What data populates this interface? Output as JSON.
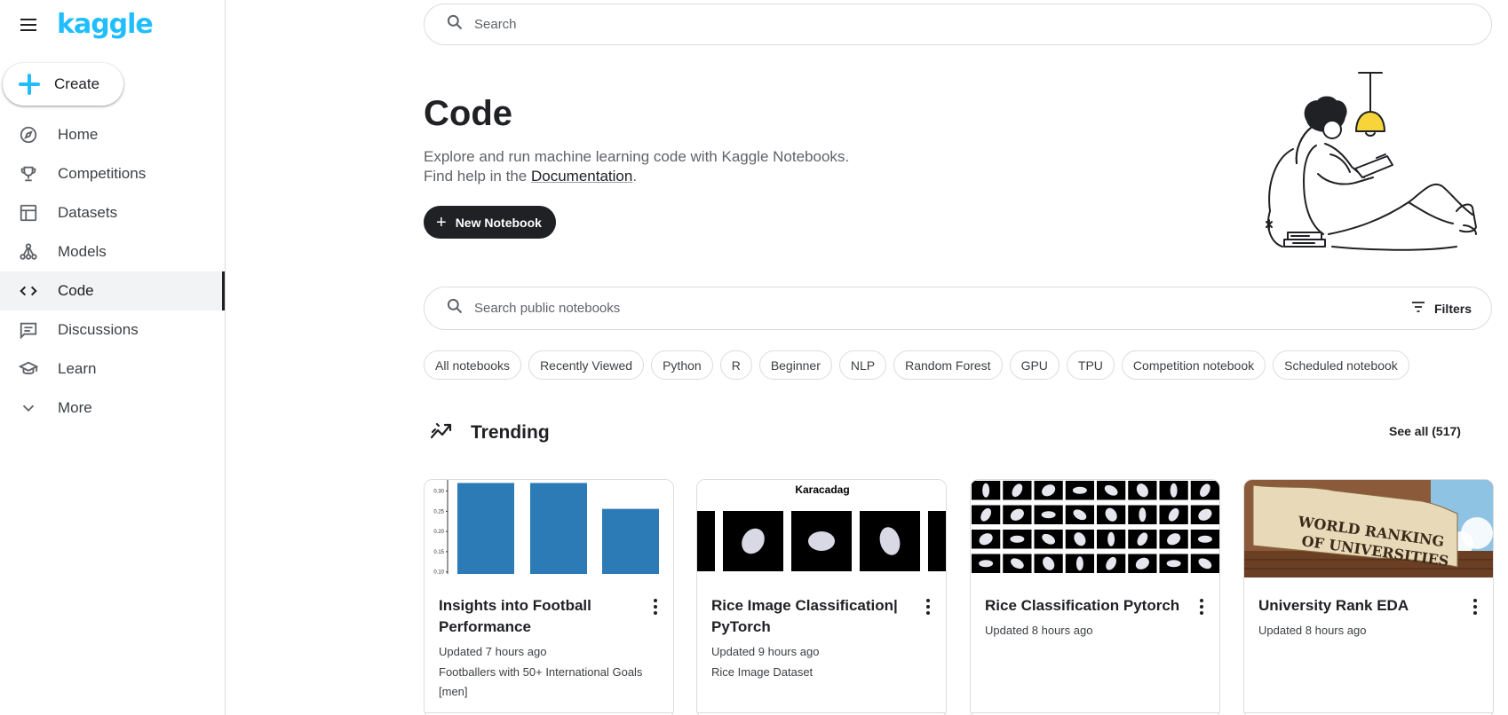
{
  "sidebar": {
    "logo": "kaggle",
    "create_label": "Create",
    "items": [
      {
        "label": "Home",
        "icon": "compass-icon"
      },
      {
        "label": "Competitions",
        "icon": "trophy-icon"
      },
      {
        "label": "Datasets",
        "icon": "table-icon"
      },
      {
        "label": "Models",
        "icon": "models-icon"
      },
      {
        "label": "Code",
        "icon": "code-icon",
        "active": true
      },
      {
        "label": "Discussions",
        "icon": "comment-icon"
      },
      {
        "label": "Learn",
        "icon": "school-icon"
      },
      {
        "label": "More",
        "icon": "chevron-down-icon"
      }
    ]
  },
  "header": {
    "search_placeholder": "Search"
  },
  "hero": {
    "title": "Code",
    "desc_line1": "Explore and run machine learning code with Kaggle Notebooks.",
    "desc_line2_prefix": "Find help in the ",
    "desc_link": "Documentation",
    "desc_line2_suffix": ".",
    "new_notebook_label": "New Notebook"
  },
  "notebook_search": {
    "placeholder": "Search public notebooks",
    "filters_label": "Filters"
  },
  "chips": [
    "All notebooks",
    "Recently Viewed",
    "Python",
    "R",
    "Beginner",
    "NLP",
    "Random Forest",
    "GPU",
    "TPU",
    "Competition notebook",
    "Scheduled notebook"
  ],
  "trending": {
    "title": "Trending",
    "see_all": "See all (517)"
  },
  "cards": [
    {
      "title": "Insights into Football Performance",
      "updated": "Updated 7 hours ago",
      "source": "Footballers with 50+ International Goals [men]"
    },
    {
      "title": "Rice Image Classification| PyTorch",
      "updated": "Updated 9 hours ago",
      "source": "Rice Image Dataset",
      "thumb_title": "Karacadag"
    },
    {
      "title": "Rice Classification Pytorch",
      "updated": "Updated 8 hours ago",
      "source": ""
    },
    {
      "title": "University Rank EDA",
      "updated": "Updated 8 hours ago",
      "source": "",
      "banner_line1": "WORLD RANKING",
      "banner_line2": "OF UNIVERSITIES"
    }
  ],
  "thumb_chart": {
    "type": "bar",
    "yticks": [
      "0.30",
      "0.25",
      "0.20",
      "0.15",
      "0.10"
    ],
    "values": [
      0.32,
      0.32,
      0.256
    ],
    "ylim": [
      0.095,
      0.31
    ],
    "bar_color": "#2c7bb6"
  },
  "colors": {
    "accent": "#20beff",
    "dark": "#202124"
  }
}
